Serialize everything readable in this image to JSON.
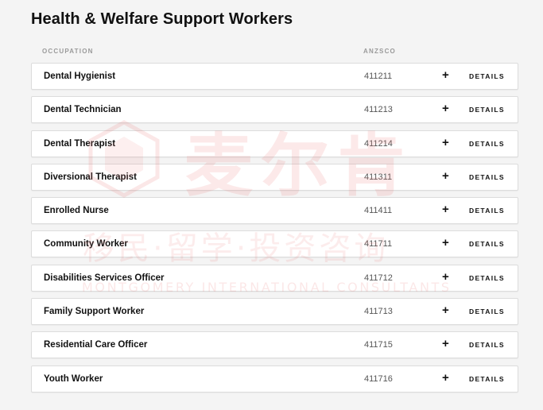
{
  "page": {
    "title": "Health & Welfare Support Workers"
  },
  "table": {
    "headers": {
      "occupation": "OCCUPATION",
      "anzsco": "ANZSCO"
    },
    "details_label": "DETAILS",
    "expand_symbol": "+",
    "rows": [
      {
        "occupation": "Dental Hygienist",
        "anzsco": "411211"
      },
      {
        "occupation": "Dental Technician",
        "anzsco": "411213"
      },
      {
        "occupation": "Dental Therapist",
        "anzsco": "411214"
      },
      {
        "occupation": "Diversional Therapist",
        "anzsco": "411311"
      },
      {
        "occupation": "Enrolled Nurse",
        "anzsco": "411411"
      },
      {
        "occupation": "Community Worker",
        "anzsco": "411711"
      },
      {
        "occupation": "Disabilities Services Officer",
        "anzsco": "411712"
      },
      {
        "occupation": "Family Support Worker",
        "anzsco": "411713"
      },
      {
        "occupation": "Residential Care Officer",
        "anzsco": "411715"
      },
      {
        "occupation": "Youth Worker",
        "anzsco": "411716"
      }
    ]
  },
  "watermark": {
    "chinese_name": "麦尔肯",
    "chinese_sub": "移民·留学·投资咨询",
    "english": "MONTGOMERY INTERNATIONAL CONSULTANTS",
    "color": "#eb7878"
  }
}
